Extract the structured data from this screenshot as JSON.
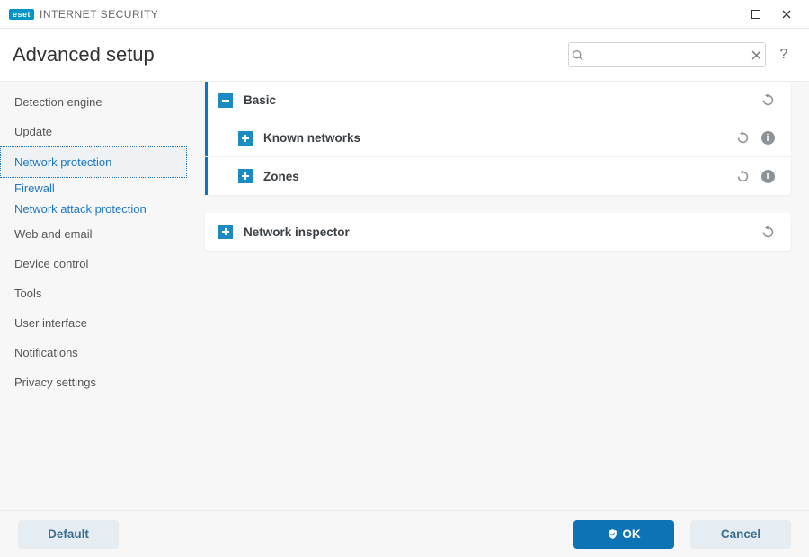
{
  "brand": {
    "badge": "eset",
    "product": "INTERNET SECURITY"
  },
  "header": {
    "title": "Advanced setup",
    "search_placeholder": "",
    "help_label": "?"
  },
  "sidebar": {
    "items": [
      {
        "label": "Detection engine"
      },
      {
        "label": "Update"
      },
      {
        "label": "Network protection",
        "active": true
      },
      {
        "label": "Web and email"
      },
      {
        "label": "Device control"
      },
      {
        "label": "Tools"
      },
      {
        "label": "User interface"
      },
      {
        "label": "Notifications"
      },
      {
        "label": "Privacy settings"
      }
    ],
    "sub": [
      {
        "label": "Firewall"
      },
      {
        "label": "Network attack protection"
      }
    ]
  },
  "content": {
    "panel1": {
      "rows": [
        {
          "label": "Basic",
          "expanded": true,
          "reset": true,
          "info": false
        },
        {
          "label": "Known networks",
          "expanded": false,
          "sub": true,
          "reset": true,
          "info": true
        },
        {
          "label": "Zones",
          "expanded": false,
          "sub": true,
          "reset": true,
          "info": true
        }
      ]
    },
    "panel2": {
      "rows": [
        {
          "label": "Network inspector",
          "expanded": false,
          "reset": true,
          "info": false
        }
      ]
    }
  },
  "footer": {
    "default_label": "Default",
    "ok_label": "OK",
    "cancel_label": "Cancel"
  },
  "icons": {
    "info_glyph": "i"
  }
}
